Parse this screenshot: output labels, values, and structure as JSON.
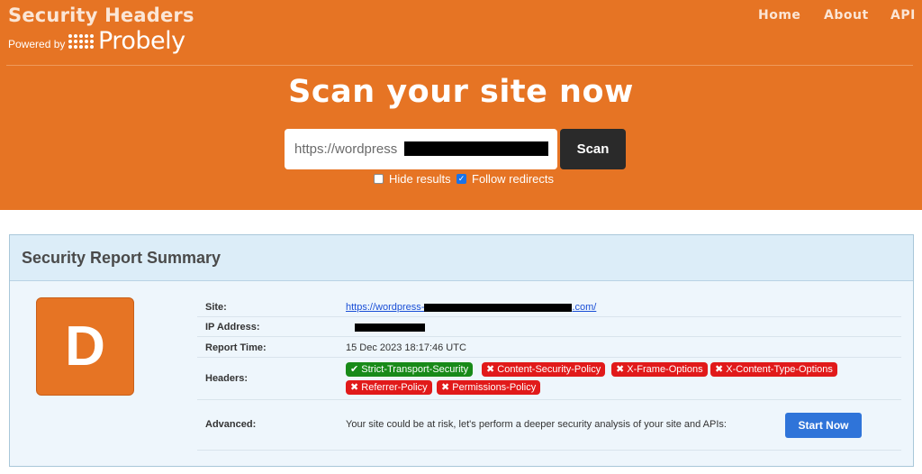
{
  "brand": {
    "title": "Security Headers",
    "powered_by": "Powered by",
    "partner": "Probely"
  },
  "nav": [
    "Home",
    "About",
    "API"
  ],
  "hero": {
    "headline": "Scan your site now",
    "url_value": "https://wordpress",
    "scan_label": "Scan"
  },
  "options": [
    {
      "label": "Hide results",
      "checked": false
    },
    {
      "label": "Follow redirects",
      "checked": true
    }
  ],
  "report": {
    "title": "Security Report Summary",
    "grade": "D",
    "site_label": "Site:",
    "site_value_start": "https://wordpress-",
    "site_value_end": ".com/",
    "ip_label": "IP Address:",
    "time_label": "Report Time:",
    "time_value": "15 Dec 2023 18:17:46 UTC",
    "headers_label": "Headers:",
    "headers": [
      {
        "name": "Strict-Transport-Security",
        "present": true
      },
      {
        "name": "Content-Security-Policy",
        "present": false
      },
      {
        "name": "X-Frame-Options",
        "present": false
      },
      {
        "name": "X-Content-Type-Options",
        "present": false
      },
      {
        "name": "Referrer-Policy",
        "present": false
      },
      {
        "name": "Permissions-Policy",
        "present": false
      }
    ],
    "advanced_label": "Advanced:",
    "advanced_text": "Your site could be at risk, let's perform a deeper security analysis of your site and APIs:",
    "start_label": "Start Now"
  },
  "colors": {
    "brand_orange": "#e67424",
    "present_green": "#188a18",
    "missing_red": "#e11a1a",
    "cta_blue": "#2f74d9"
  }
}
